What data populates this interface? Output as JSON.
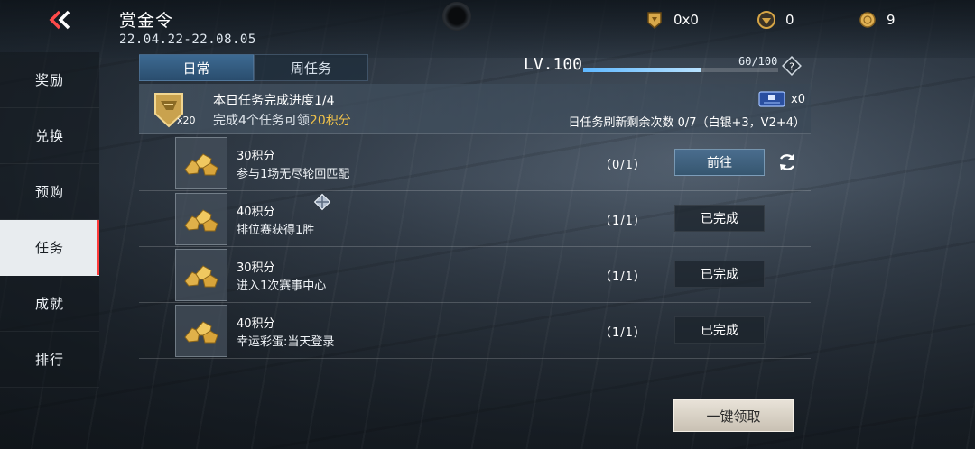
{
  "header": {
    "title": "赏金令",
    "date_range": "22.04.22-22.08.05"
  },
  "currencies": [
    {
      "icon": "gold-medal-icon",
      "value": "0x0"
    },
    {
      "icon": "skull-badge-icon",
      "value": "0"
    },
    {
      "icon": "coin-icon",
      "value": "9"
    }
  ],
  "sidebar": {
    "items": [
      {
        "label": "奖励",
        "active": false
      },
      {
        "label": "兑换",
        "active": false
      },
      {
        "label": "预购",
        "active": false
      },
      {
        "label": "任务",
        "active": true
      },
      {
        "label": "成就",
        "active": false
      },
      {
        "label": "排行",
        "active": false
      }
    ]
  },
  "tabs": [
    {
      "label": "日常",
      "active": true
    },
    {
      "label": "周任务",
      "active": false
    }
  ],
  "level": {
    "label": "LV.100",
    "xp_text": "60/100",
    "xp_fraction": 0.6
  },
  "daily": {
    "badge_count": "x20",
    "title": "本日任务完成进度1/4",
    "sub_prefix": "完成4个任务可领",
    "sub_highlight": "20积分",
    "ticket_count": "x0",
    "refresh_info": "日任务刷新剩余次数 0/7（白银+3，V2+4）"
  },
  "tasks": [
    {
      "points": "30积分",
      "desc": "参与1场无尽轮回匹配",
      "progress": "（0/1）",
      "button": "前往",
      "state": "go"
    },
    {
      "points": "40积分",
      "desc": "排位赛获得1胜",
      "progress": "（1/1）",
      "button": "已完成",
      "state": "done"
    },
    {
      "points": "30积分",
      "desc": "进入1次赛事中心",
      "progress": "（1/1）",
      "button": "已完成",
      "state": "done"
    },
    {
      "points": "40积分",
      "desc": "幸运彩蛋:当天登录",
      "progress": "（1/1）",
      "button": "已完成",
      "state": "done"
    }
  ],
  "claim_all_label": "一键领取",
  "colors": {
    "accent_red": "#ff3b3b",
    "highlight_gold": "#f0c24a",
    "xp_blue": "#5fb8ff"
  }
}
